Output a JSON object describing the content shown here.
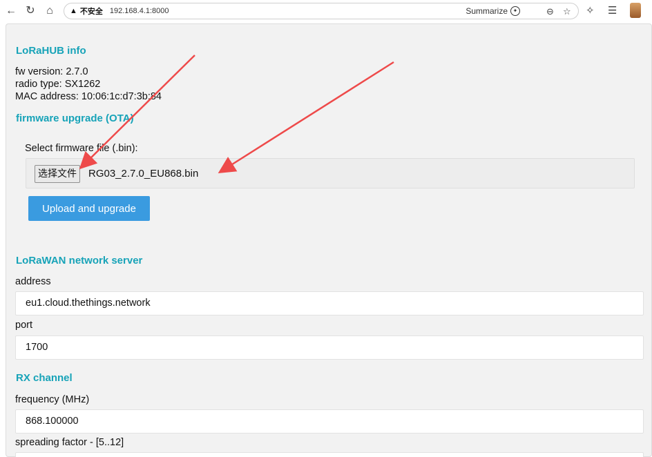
{
  "browser": {
    "security_label": "不安全",
    "url": "192.168.4.1:8000",
    "summarize_label": "Summarize"
  },
  "info": {
    "title": "LoRaHUB info",
    "fw_version": "fw version: 2.7.0",
    "radio_type": "radio type: SX1262",
    "mac_address": "MAC address: 10:06:1c:d7:3b:84"
  },
  "firmware": {
    "title": "firmware upgrade (OTA)",
    "select_label": "Select firmware file (.bin):",
    "choose_file_label": "选择文件",
    "selected_file": "RG03_2.7.0_EU868.bin",
    "upload_label": "Upload and upgrade"
  },
  "network_server": {
    "title": "LoRaWAN network server",
    "address_label": "address",
    "address_value": "eu1.cloud.thethings.network",
    "port_label": "port",
    "port_value": "1700"
  },
  "rx_channel": {
    "title": "RX channel",
    "frequency_label": "frequency (MHz)",
    "frequency_value": "868.100000",
    "sf_label": "spreading factor - [5..12]"
  },
  "colors": {
    "section_title": "#17a3b8",
    "upload_button": "#3a9be0",
    "annotation_arrow": "#ee4a4a"
  }
}
